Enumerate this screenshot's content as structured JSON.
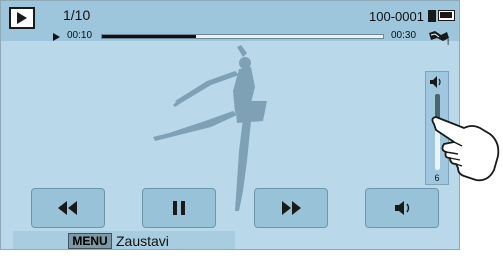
{
  "header": {
    "counter": "1/10",
    "file_number": "100-0001"
  },
  "playback": {
    "current_time": "00:10",
    "total_time": "00:30",
    "progress_fraction": 0.333
  },
  "volume": {
    "level": 6,
    "level_fraction": 0.6
  },
  "controls": {
    "rewind": "rewind-icon",
    "pause": "pause-icon",
    "fast_forward": "fast-forward-icon",
    "volume": "speaker-icon"
  },
  "menu": {
    "key_label": "MENU",
    "action_label": "Zaustavi"
  },
  "colors": {
    "screen_bg": "#b9d9ea",
    "topbar_bg": "#9dc6dc",
    "button_bg": "#98c2d8",
    "icon": "#1a1a1a"
  }
}
